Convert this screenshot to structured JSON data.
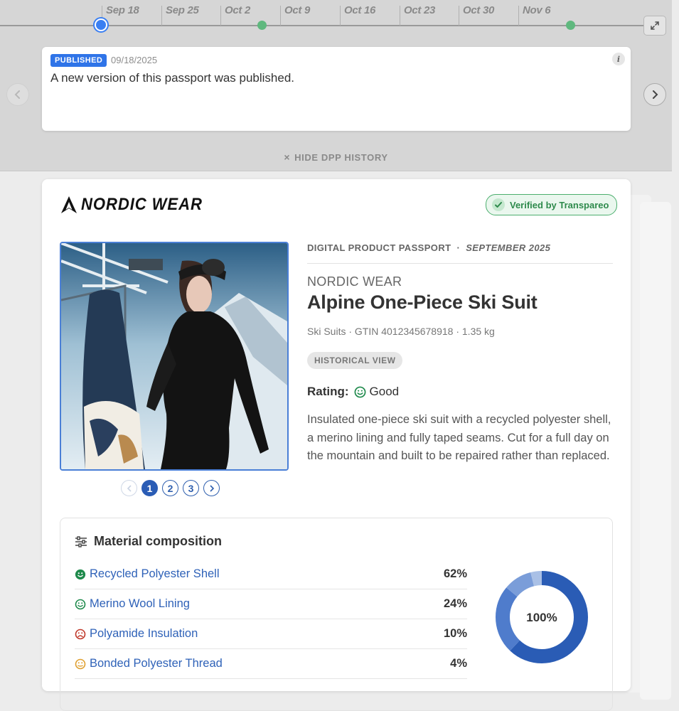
{
  "timeline": {
    "labels": [
      "Sep 18",
      "Sep 25",
      "Oct 2",
      "Oct 9",
      "Oct 16",
      "Oct 23",
      "Oct 30",
      "Nov 6"
    ]
  },
  "event": {
    "status_badge": "PUBLISHED",
    "date": "09/18/2025",
    "message": "A new version of this passport was published.",
    "info_glyph": "i"
  },
  "history_toggle": {
    "label": "HIDE DPP HISTORY",
    "icon": "×"
  },
  "passport": {
    "brand_logo_text": "NORDIC WEAR",
    "verified_label": "Verified by Transpareo",
    "kicker": "DIGITAL PRODUCT PASSPORT",
    "kicker_sep": "·",
    "kicker_date": "SEPTEMBER 2025",
    "brand": "NORDIC WEAR",
    "title": "Alpine One-Piece Ski Suit",
    "meta": "Ski Suits · GTIN 4012345678918 · 1.35 kg",
    "view_badge": "HISTORICAL VIEW",
    "rating_label": "Rating:",
    "rating_value": "Good",
    "description": "Insulated one-piece ski suit with a recycled polyester shell, a merino lining and fully taped seams. Cut for a full day on the mountain and built to be repaired rather than replaced.",
    "pager": {
      "pages": [
        "1",
        "2",
        "3"
      ],
      "active": "1"
    }
  },
  "materials": {
    "heading": "Material composition",
    "items": [
      {
        "name": "Recycled Polyester Shell",
        "pct": "62%",
        "rating": "good",
        "color": "#2a5cb5"
      },
      {
        "name": "Merino Wool Lining",
        "pct": "24%",
        "rating": "good",
        "color": "#4f7ccc"
      },
      {
        "name": "Polyamide Insulation",
        "pct": "10%",
        "rating": "bad",
        "color": "#7a9dd9"
      },
      {
        "name": "Bonded Polyester Thread",
        "pct": "4%",
        "rating": "medium",
        "color": "#a9c0e6"
      }
    ],
    "total_label": "100%"
  },
  "colors": {
    "accent": "#2f74e8",
    "link": "#2f62b8",
    "good": "#1f8a4c",
    "bad": "#c0392b",
    "medium": "#e0a030",
    "verified": "#2e8a4c"
  }
}
